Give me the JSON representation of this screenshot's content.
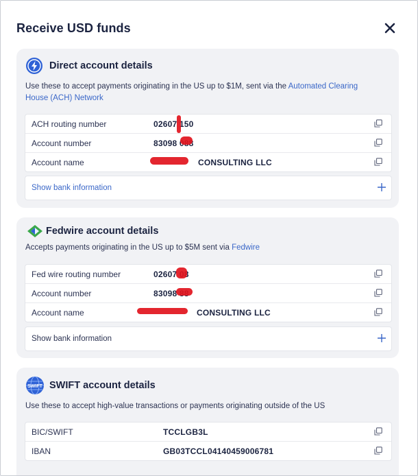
{
  "modal": {
    "title": "Receive USD funds",
    "close_icon": "close-icon",
    "accent_color": "#3a67c8"
  },
  "direct": {
    "title": "Direct account details",
    "icon": "lightning-bolt-icon",
    "description_pre": "Use these to accept payments originating in the US up to $1M, sent via the ",
    "description_link": "Automated Clearing House (ACH) Network",
    "rows": [
      {
        "label": "ACH routing number",
        "value": "02607 150"
      },
      {
        "label": "Account number",
        "value": "83098 088"
      },
      {
        "label": "Account name",
        "value": "CONSULTING LLC"
      }
    ],
    "bank_info": "Show bank information"
  },
  "fedwire": {
    "title": "Fedwire account details",
    "icon": "fedwire-logo-icon",
    "description_pre": "Accepts payments originating in the US up to $5M sent via ",
    "description_link": "Fedwire",
    "rows": [
      {
        "label": "Fed wire routing number",
        "value": "02607 08"
      },
      {
        "label": "Account number",
        "value": "83098 88"
      },
      {
        "label": "Account name",
        "value": "CONSULTING LLC"
      }
    ],
    "bank_info": "Show bank information"
  },
  "swift": {
    "title": "SWIFT account details",
    "icon": "swift-globe-icon",
    "logo_text": "SWIFT",
    "description": "Use these to accept high-value transactions or payments originating outside of the US",
    "rows": [
      {
        "label": "BIC/SWIFT",
        "value": "TCCLGB3L"
      },
      {
        "label": "IBAN",
        "value": "GB03TCCL04140459006781"
      }
    ]
  }
}
